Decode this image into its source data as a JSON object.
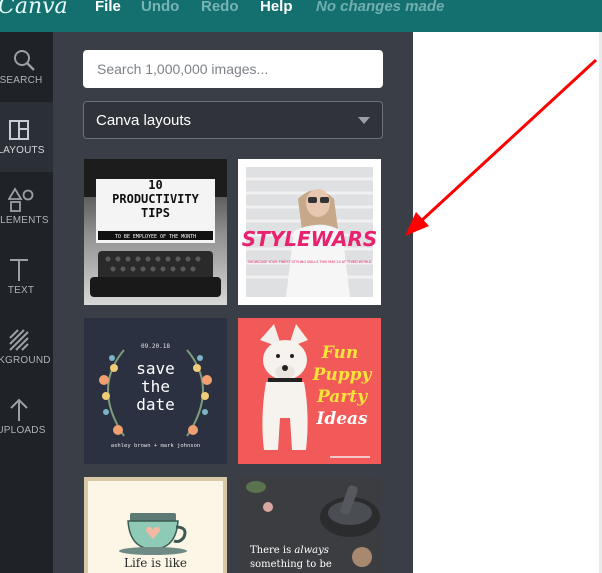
{
  "menubar": {
    "logo": "Canva",
    "items": [
      "File",
      "Undo",
      "Redo",
      "Help"
    ],
    "status": "No changes made"
  },
  "leftrail": {
    "items": [
      {
        "label": "SEARCH",
        "icon": "search-icon"
      },
      {
        "label": "LAYOUTS",
        "icon": "layouts-icon"
      },
      {
        "label": "ELEMENTS",
        "icon": "elements-icon"
      },
      {
        "label": "TEXT",
        "icon": "text-icon"
      },
      {
        "label": "BKGROUND",
        "icon": "background-icon"
      },
      {
        "label": "UPLOADS",
        "icon": "uploads-icon"
      }
    ],
    "active": "LAYOUTS"
  },
  "panel": {
    "search_placeholder": "Search 1,000,000 images...",
    "select_value": "Canva layouts"
  },
  "layouts": {
    "t1": {
      "line1": "10",
      "line2": "PRODUCTIVITY",
      "line3": "TIPS",
      "caption": "TO BE EMPLOYEE OF THE MONTH"
    },
    "t2": {
      "title": "STYLEWARS",
      "caption": "SHOWCASE YOUR FINEST STYLING SKILLS THIS MAY 20 AT THIRD WORLD"
    },
    "t3": {
      "date": "09.20.18",
      "line1": "save",
      "line2": "the",
      "line3": "date",
      "names": "ashley brown + mark johnson"
    },
    "t4": {
      "line1": "Fun",
      "line2": "Puppy",
      "line3": "Party",
      "line4": "Ideas"
    },
    "t5": {
      "text": "Life is like"
    },
    "t6": {
      "line1a": "There is ",
      "line1b": "always",
      "line2": "something to be"
    }
  },
  "colors": {
    "topbar": "#13706f",
    "panel": "#3a3f47",
    "rail": "#1f2226",
    "arrow": "#ff0000",
    "stylewars_pink": "#e8226e",
    "puppy_bg": "#f25a5a",
    "puppy_yellow": "#f7e33a"
  }
}
